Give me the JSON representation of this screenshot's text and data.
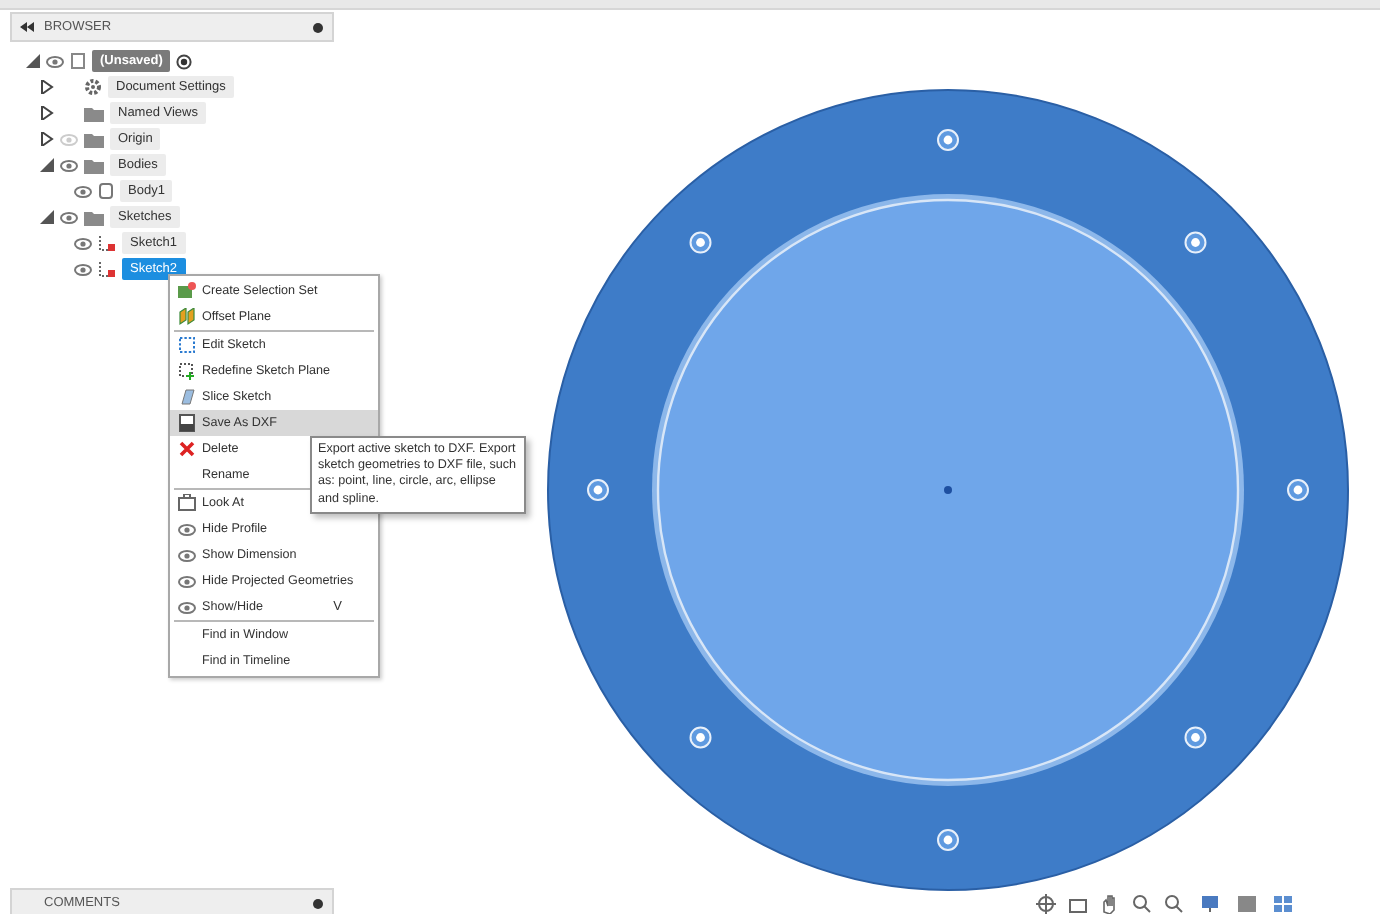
{
  "browser": {
    "title": "BROWSER",
    "tree": [
      {
        "label": "(Unsaved)",
        "kind": "component",
        "expanded": true,
        "visible": true,
        "selected": false,
        "children": [
          {
            "label": "Document Settings",
            "kind": "gear",
            "expanded": false,
            "selected": false
          },
          {
            "label": "Named Views",
            "kind": "folder",
            "expanded": false,
            "selected": false
          },
          {
            "label": "Origin",
            "kind": "folder",
            "expanded": false,
            "visible": false,
            "selected": false
          },
          {
            "label": "Bodies",
            "kind": "folder",
            "expanded": true,
            "visible": true,
            "selected": false,
            "children": [
              {
                "label": "Body1",
                "kind": "body",
                "visible": true,
                "selected": false
              }
            ]
          },
          {
            "label": "Sketches",
            "kind": "folder",
            "expanded": true,
            "visible": true,
            "selected": false,
            "children": [
              {
                "label": "Sketch1",
                "kind": "sketch",
                "visible": true,
                "selected": false
              },
              {
                "label": "Sketch2",
                "kind": "sketch",
                "visible": true,
                "selected": true
              }
            ]
          }
        ]
      }
    ]
  },
  "context_menu": {
    "groups": [
      [
        {
          "label": "Create Selection Set",
          "kind": "selection",
          "highlighted": false
        },
        {
          "label": "Offset Plane",
          "kind": "plane",
          "highlighted": false
        }
      ],
      [
        {
          "label": "Edit Sketch",
          "kind": "sketch",
          "highlighted": false
        },
        {
          "label": "Redefine Sketch Plane",
          "kind": "redefine",
          "highlighted": false
        },
        {
          "label": "Slice Sketch",
          "kind": "slice",
          "highlighted": false
        },
        {
          "label": "Save As DXF",
          "kind": "dxf",
          "highlighted": true
        },
        {
          "label": "Delete",
          "kind": "delete",
          "highlighted": false
        },
        {
          "label": "Rename",
          "kind": "plain",
          "highlighted": false
        }
      ],
      [
        {
          "label": "Look At",
          "kind": "lookat",
          "highlighted": false
        },
        {
          "label": "Hide Profile",
          "kind": "eye",
          "highlighted": false
        },
        {
          "label": "Show Dimension",
          "kind": "eye",
          "highlighted": false
        },
        {
          "label": "Hide Projected Geometries",
          "kind": "eye",
          "highlighted": false
        },
        {
          "label": "Show/Hide",
          "kind": "eye",
          "highlighted": false,
          "shortcut": "V"
        }
      ],
      [
        {
          "label": "Find in Window",
          "kind": "plain",
          "highlighted": false
        },
        {
          "label": "Find in Timeline",
          "kind": "plain",
          "highlighted": false
        }
      ]
    ]
  },
  "tooltip": "Export active sketch to DXF. Export sketch geometries to DXF file, such as: point, line, circle, arc, ellipse and spline.",
  "comments": {
    "title": "COMMENTS"
  }
}
